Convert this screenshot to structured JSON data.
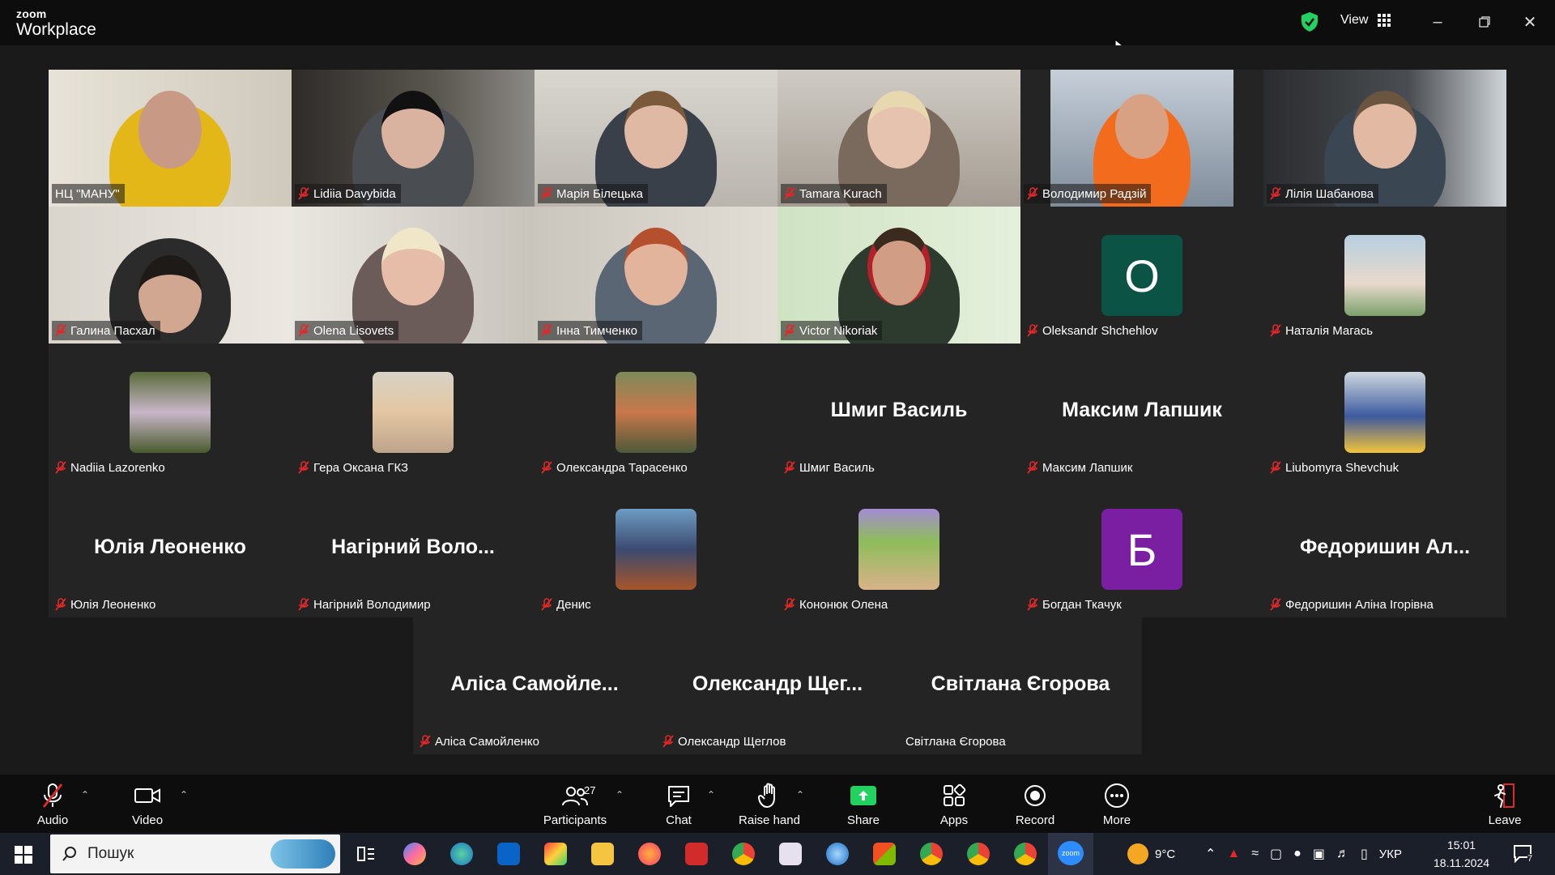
{
  "titlebar": {
    "brand_small": "zoom",
    "brand_big": "Workplace",
    "view_label": "View"
  },
  "participants": [
    {
      "name": "НЦ \"МАНУ\"",
      "type": "video",
      "active": true,
      "muted": false
    },
    {
      "name": "Lidiia Davybida",
      "type": "video",
      "muted": true
    },
    {
      "name": "Марія Білецька",
      "type": "video",
      "muted": true
    },
    {
      "name": "Tamara Kurach",
      "type": "video",
      "muted": true
    },
    {
      "name": "Володимир Радзій",
      "type": "video",
      "muted": true
    },
    {
      "name": "Лілія Шабанова",
      "type": "video",
      "muted": true
    },
    {
      "name": "Галина Пасхал",
      "type": "video",
      "muted": true
    },
    {
      "name": "Olena Lisovets",
      "type": "video",
      "muted": true
    },
    {
      "name": "Інна Тимченко",
      "type": "video",
      "muted": true
    },
    {
      "name": "Victor Nikoriak",
      "type": "video",
      "muted": true
    },
    {
      "name": "Oleksandr Shchehlov",
      "type": "letter",
      "letter": "O",
      "color": "#0b5345",
      "muted": true
    },
    {
      "name": "Наталія Магась",
      "type": "photo",
      "muted": true
    },
    {
      "name": "Nadiia Lazorenko",
      "type": "photo",
      "muted": true
    },
    {
      "name": "Гера Оксана ГКЗ",
      "type": "photo",
      "muted": true
    },
    {
      "name": "Олександра Тарасенко",
      "type": "photo",
      "muted": true
    },
    {
      "name": "Шмиг Василь",
      "type": "name",
      "display": "Шмиг Василь",
      "muted": true
    },
    {
      "name": "Максим Лапшик",
      "type": "name",
      "display": "Максим Лапшик",
      "muted": true
    },
    {
      "name": "Liubomyra Shevchuk",
      "type": "photo",
      "muted": true
    },
    {
      "name": "Юлія Леоненко",
      "type": "name",
      "display": "Юлія Леоненко",
      "muted": true
    },
    {
      "name": "Нагірний Володимир",
      "type": "name",
      "display": "Нагірний Воло...",
      "muted": true
    },
    {
      "name": "Денис",
      "type": "photo",
      "muted": true
    },
    {
      "name": "Кононюк Олена",
      "type": "photo",
      "muted": true
    },
    {
      "name": "Богдан Ткачук",
      "type": "letter",
      "letter": "Б",
      "color": "#7b1fa2",
      "muted": true
    },
    {
      "name": "Федоришин Аліна Ігорівна",
      "type": "name",
      "display": "Федоришин Ал...",
      "muted": true
    },
    {
      "name": "Аліса Самойленко",
      "type": "name",
      "display": "Аліса Самойле...",
      "muted": true
    },
    {
      "name": "Олександр Щеглов",
      "type": "name",
      "display": "Олександр Щег...",
      "muted": true
    },
    {
      "name": "Світлана Єгорова",
      "type": "name",
      "display": "Світлана Єгорова",
      "muted": false
    }
  ],
  "toolbar": {
    "audio": "Audio",
    "video": "Video",
    "participants": "Participants",
    "participants_count": "27",
    "chat": "Chat",
    "raise_hand": "Raise hand",
    "share": "Share",
    "apps": "Apps",
    "record": "Record",
    "more": "More",
    "leave": "Leave"
  },
  "taskbar": {
    "search_placeholder": "Пошук",
    "weather": "9°C",
    "language": "УКР",
    "time": "15:01",
    "date": "18.11.2024",
    "notifications": "7"
  },
  "colors": {
    "active_border": "#23d160",
    "mute_red": "#e02828",
    "share_green": "#23d160"
  }
}
